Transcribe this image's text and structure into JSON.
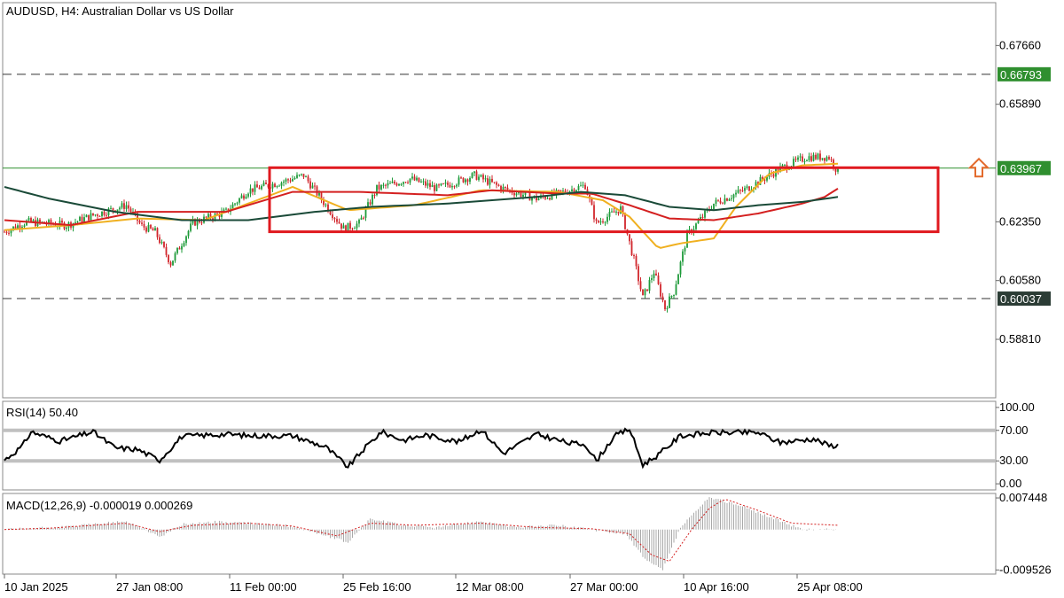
{
  "window": {
    "title": "AUDUSD, H4:  Australian Dollar vs US Dollar"
  },
  "chart_data": [
    {
      "type": "candlestick",
      "symbol": "AUDUSD",
      "timeframe": "H4",
      "title": "AUDUSD, H4:  Australian Dollar vs US Dollar",
      "ylim": [
        0.5705,
        0.6895
      ],
      "y_ticks": [
        "0.67660",
        "0.65890",
        "0.62350",
        "0.60580",
        "0.58810"
      ],
      "x_ticks": [
        "10 Jan 2025",
        "27 Jan 08:00",
        "11 Feb 00:00",
        "25 Feb 16:00",
        "12 Mar 08:00",
        "27 Mar 00:00",
        "10 Apr 16:00",
        "25 Apr 08:00"
      ],
      "close_path": [
        [
          0,
          0.6205
        ],
        [
          10,
          0.6235
        ],
        [
          28,
          0.6225
        ],
        [
          40,
          0.6255
        ],
        [
          55,
          0.6285
        ],
        [
          62,
          0.6222
        ],
        [
          68,
          0.6205
        ],
        [
          75,
          0.611
        ],
        [
          85,
          0.6232
        ],
        [
          100,
          0.6265
        ],
        [
          110,
          0.633
        ],
        [
          125,
          0.6355
        ],
        [
          135,
          0.6375
        ],
        [
          145,
          0.6285
        ],
        [
          153,
          0.6215
        ],
        [
          160,
          0.623
        ],
        [
          168,
          0.6335
        ],
        [
          183,
          0.6365
        ],
        [
          195,
          0.6335
        ],
        [
          212,
          0.6375
        ],
        [
          225,
          0.6335
        ],
        [
          240,
          0.6305
        ],
        [
          250,
          0.632
        ],
        [
          262,
          0.6345
        ],
        [
          267,
          0.623
        ],
        [
          278,
          0.6275
        ],
        [
          284,
          0.612
        ],
        [
          288,
          0.6005
        ],
        [
          293,
          0.6085
        ],
        [
          298,
          0.5975
        ],
        [
          302,
          0.6025
        ],
        [
          308,
          0.6195
        ],
        [
          320,
          0.629
        ],
        [
          335,
          0.6335
        ],
        [
          350,
          0.6395
        ],
        [
          362,
          0.643
        ],
        [
          372,
          0.643
        ],
        [
          376,
          0.6385
        ]
      ],
      "series": [
        {
          "name": "",
          "color": "#f0b020",
          "values": [
            [
              0,
              0.621
            ],
            [
              30,
              0.6225
            ],
            [
              60,
              0.6245
            ],
            [
              90,
              0.624
            ],
            [
              130,
              0.634
            ],
            [
              155,
              0.627
            ],
            [
              185,
              0.6285
            ],
            [
              215,
              0.633
            ],
            [
              250,
              0.6325
            ],
            [
              270,
              0.63
            ],
            [
              282,
              0.625
            ],
            [
              295,
              0.6155
            ],
            [
              305,
              0.617
            ],
            [
              320,
              0.6185
            ],
            [
              330,
              0.628
            ],
            [
              345,
              0.638
            ],
            [
              360,
              0.6405
            ],
            [
              376,
              0.641
            ]
          ]
        },
        {
          "name": "",
          "color": "#d42020",
          "values": [
            [
              0,
              0.624
            ],
            [
              30,
              0.6225
            ],
            [
              60,
              0.6265
            ],
            [
              100,
              0.6265
            ],
            [
              130,
              0.6325
            ],
            [
              160,
              0.6325
            ],
            [
              200,
              0.6315
            ],
            [
              220,
              0.633
            ],
            [
              250,
              0.632
            ],
            [
              265,
              0.632
            ],
            [
              282,
              0.6285
            ],
            [
              300,
              0.6245
            ],
            [
              320,
              0.624
            ],
            [
              340,
              0.626
            ],
            [
              360,
              0.629
            ],
            [
              370,
              0.631
            ],
            [
              376,
              0.6335
            ]
          ]
        },
        {
          "name": "",
          "color": "#1a4a38",
          "values": [
            [
              0,
              0.634
            ],
            [
              20,
              0.6305
            ],
            [
              50,
              0.6265
            ],
            [
              80,
              0.624
            ],
            [
              110,
              0.624
            ],
            [
              140,
              0.6265
            ],
            [
              165,
              0.628
            ],
            [
              200,
              0.629
            ],
            [
              240,
              0.631
            ],
            [
              260,
              0.6325
            ],
            [
              280,
              0.6315
            ],
            [
              300,
              0.628
            ],
            [
              320,
              0.627
            ],
            [
              340,
              0.6285
            ],
            [
              360,
              0.6295
            ],
            [
              376,
              0.631
            ]
          ]
        }
      ],
      "levels": [
        {
          "value": 0.66793,
          "label": "0.66793",
          "style": "dashed",
          "tag_color": "#2f8f2f"
        },
        {
          "value": 0.63967,
          "label": "0.63967",
          "style": "solid",
          "tag_color": "#2f8f2f"
        },
        {
          "value": 0.60037,
          "label": "0.60037",
          "style": "dashed",
          "tag_color": "#2b3c35"
        }
      ],
      "range_box": {
        "top": 0.6398,
        "bottom": 0.6205,
        "color": "#e0191f"
      },
      "arrow": {
        "direction": "up",
        "color": "#e36a2c"
      }
    },
    {
      "type": "line",
      "title": "RSI(14) 50.40",
      "ylim": [
        -8,
        108
      ],
      "y_ticks": [
        "100.00",
        "70.00",
        "30.00",
        "0.00"
      ],
      "levels": [
        70,
        30
      ],
      "current": 50.4,
      "values": [
        [
          0,
          31
        ],
        [
          8,
          49
        ],
        [
          12,
          68
        ],
        [
          25,
          56
        ],
        [
          40,
          68
        ],
        [
          50,
          47
        ],
        [
          60,
          45
        ],
        [
          70,
          31
        ],
        [
          80,
          62
        ],
        [
          100,
          65
        ],
        [
          110,
          63
        ],
        [
          130,
          63
        ],
        [
          145,
          48
        ],
        [
          155,
          22
        ],
        [
          162,
          45
        ],
        [
          170,
          68
        ],
        [
          180,
          57
        ],
        [
          190,
          64
        ],
        [
          205,
          55
        ],
        [
          215,
          71
        ],
        [
          225,
          40
        ],
        [
          240,
          65
        ],
        [
          255,
          53
        ],
        [
          262,
          52
        ],
        [
          267,
          30
        ],
        [
          275,
          62
        ],
        [
          282,
          72
        ],
        [
          288,
          25
        ],
        [
          295,
          38
        ],
        [
          305,
          63
        ],
        [
          320,
          67
        ],
        [
          340,
          67
        ],
        [
          350,
          54
        ],
        [
          365,
          59
        ],
        [
          372,
          50
        ],
        [
          376,
          50.4
        ]
      ]
    },
    {
      "type": "bar",
      "title": "MACD(12,26,9) -0.000019 0.000269",
      "ylim": [
        -0.0105,
        0.0085
      ],
      "y_ticks": [
        "0.007448",
        "-0.009526"
      ],
      "current": [
        -1.9e-05,
        0.000269
      ],
      "histogram": [
        [
          0,
          0.0
        ],
        [
          15,
          0.0003
        ],
        [
          30,
          0.0007
        ],
        [
          45,
          0.0015
        ],
        [
          55,
          0.0018
        ],
        [
          62,
          0.0005
        ],
        [
          70,
          -0.0018
        ],
        [
          80,
          0.0012
        ],
        [
          95,
          0.0018
        ],
        [
          110,
          0.0015
        ],
        [
          130,
          0.0008
        ],
        [
          145,
          -0.0015
        ],
        [
          155,
          -0.003
        ],
        [
          165,
          0.0025
        ],
        [
          180,
          0.001
        ],
        [
          195,
          0.0005
        ],
        [
          215,
          0.002
        ],
        [
          230,
          0.0005
        ],
        [
          250,
          0.001
        ],
        [
          265,
          0.0
        ],
        [
          280,
          -0.001
        ],
        [
          290,
          -0.0075
        ],
        [
          297,
          -0.0095
        ],
        [
          305,
          0.0005
        ],
        [
          318,
          0.0075
        ],
        [
          330,
          0.006
        ],
        [
          345,
          0.003
        ],
        [
          360,
          0.0
        ],
        [
          376,
          0.0
        ]
      ],
      "signal": [
        [
          0,
          0.0
        ],
        [
          20,
          0.0003
        ],
        [
          40,
          0.001
        ],
        [
          55,
          0.0015
        ],
        [
          70,
          -0.0005
        ],
        [
          85,
          0.001
        ],
        [
          110,
          0.0015
        ],
        [
          130,
          0.0008
        ],
        [
          150,
          -0.0015
        ],
        [
          165,
          0.0015
        ],
        [
          185,
          0.001
        ],
        [
          215,
          0.0015
        ],
        [
          240,
          0.0005
        ],
        [
          265,
          0.0002
        ],
        [
          282,
          -0.001
        ],
        [
          292,
          -0.006
        ],
        [
          300,
          -0.0075
        ],
        [
          310,
          0.0
        ],
        [
          318,
          0.005
        ],
        [
          325,
          0.0072
        ],
        [
          340,
          0.0045
        ],
        [
          355,
          0.0015
        ],
        [
          376,
          0.001
        ]
      ]
    }
  ]
}
